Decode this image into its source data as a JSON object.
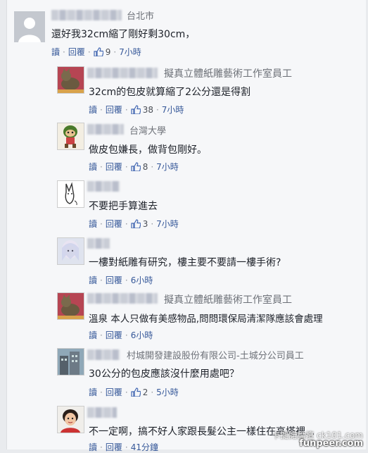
{
  "common": {
    "read": "讀",
    "reply": "回覆",
    "dot": "·"
  },
  "comments": [
    {
      "aff": "台北市",
      "text": "還好我32cm縮了剛好剩30cm，",
      "likes": "9",
      "time": "7小時"
    },
    {
      "aff": "擬真立體紙雕藝術工作室員工",
      "text": "32cm的包皮就算縮了2公分還是得割",
      "likes": "38",
      "time": "7小時"
    },
    {
      "aff": "台灣大學",
      "text": "做皮包嫌長，做背包剛好。",
      "likes": "8",
      "time": "7小時"
    },
    {
      "aff": "",
      "text": "不要把手算進去",
      "likes": "3",
      "time": "7小時"
    },
    {
      "aff": "",
      "text": "一樓對紙雕有研究，樓主要不要請一樓手術?",
      "likes": "",
      "time": "6小時"
    },
    {
      "aff": "擬真立體紙雕藝術工作室員工",
      "text": "溫泉 本人只做有美感物品,問問環保局清潔隊應該會處理",
      "likes": "",
      "time": "6小時"
    },
    {
      "aff": "村城開發建設股份有限公司-土城分公司員工",
      "text": "30公分的包皮應該沒什麼用處吧？",
      "likes": "2",
      "time": "5小時"
    },
    {
      "aff": "",
      "text": "不一定啊，搞不好人家跟長髮公主一樣住在高塔裡...",
      "likes": "",
      "time": "41分鐘"
    }
  ],
  "watermark": {
    "line1": "卡提諾論壇 ck101.com",
    "line2": "funpeer.com"
  },
  "colors": {
    "link": "#365899",
    "meta": "#90949c",
    "text": "#1d2129",
    "like": "#4267b2"
  }
}
